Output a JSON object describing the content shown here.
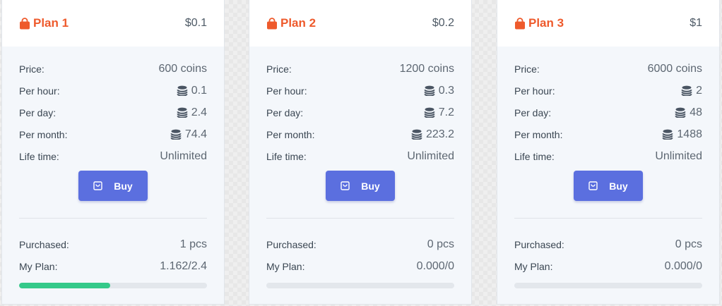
{
  "plans": [
    {
      "title": "Plan 1",
      "price": "$0.1",
      "rows": {
        "price_label": "Price:",
        "price_value": "600 coins",
        "hour_label": "Per hour:",
        "hour_value": "0.1",
        "day_label": "Per day:",
        "day_value": "2.4",
        "month_label": "Per month:",
        "month_value": "74.4",
        "life_label": "Life time:",
        "life_value": "Unlimited"
      },
      "buy_label": "Buy",
      "purchased_label": "Purchased:",
      "purchased_value": "1 pcs",
      "myplan_label": "My Plan:",
      "myplan_value": "1.162/2.4",
      "progress": 0.484
    },
    {
      "title": "Plan 2",
      "price": "$0.2",
      "rows": {
        "price_label": "Price:",
        "price_value": "1200 coins",
        "hour_label": "Per hour:",
        "hour_value": "0.3",
        "day_label": "Per day:",
        "day_value": "7.2",
        "month_label": "Per month:",
        "month_value": "223.2",
        "life_label": "Life time:",
        "life_value": "Unlimited"
      },
      "buy_label": "Buy",
      "purchased_label": "Purchased:",
      "purchased_value": "0 pcs",
      "myplan_label": "My Plan:",
      "myplan_value": "0.000/0",
      "progress": 0
    },
    {
      "title": "Plan 3",
      "price": "$1",
      "rows": {
        "price_label": "Price:",
        "price_value": "6000 coins",
        "hour_label": "Per hour:",
        "hour_value": "2",
        "day_label": "Per day:",
        "day_value": "48",
        "month_label": "Per month:",
        "month_value": "1488",
        "life_label": "Life time:",
        "life_value": "Unlimited"
      },
      "buy_label": "Buy",
      "purchased_label": "Purchased:",
      "purchased_value": "0 pcs",
      "myplan_label": "My Plan:",
      "myplan_value": "0.000/0",
      "progress": 0
    }
  ],
  "icons": {
    "title": "shopping-bag-icon",
    "coins": "coins-stack-icon",
    "buy": "shopping-bag-outline-icon"
  },
  "colors": {
    "accent": "#ee5a2c",
    "button": "#5b6fdf",
    "progress": "#35c98a"
  }
}
